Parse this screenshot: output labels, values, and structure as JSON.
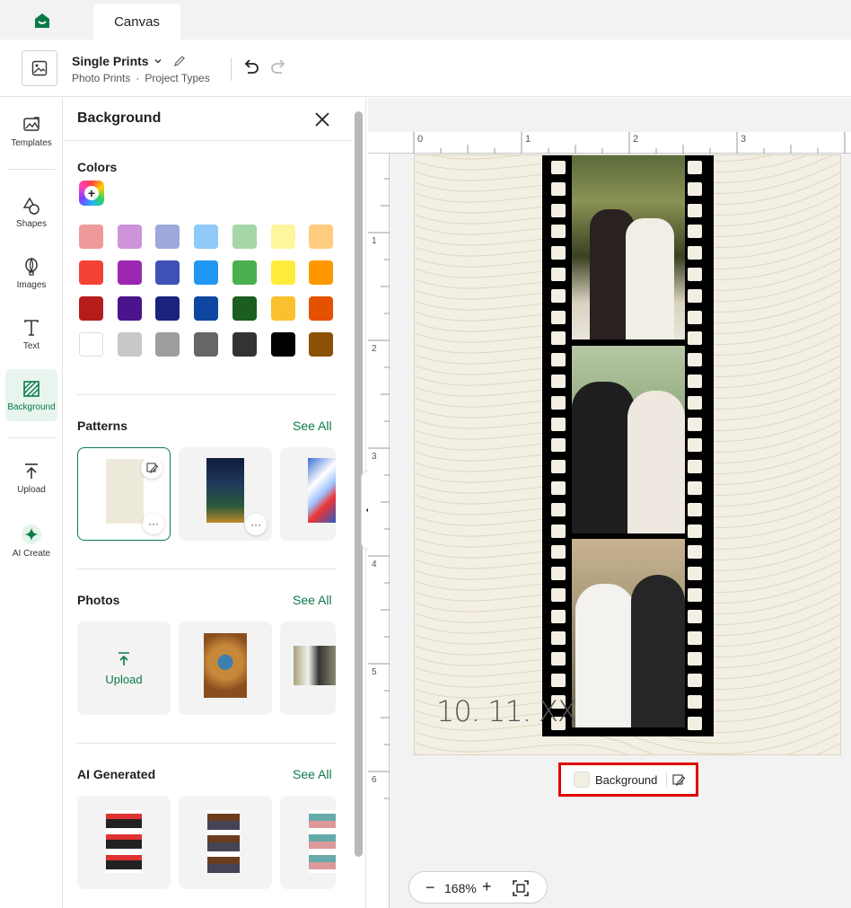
{
  "tabs": {
    "active_tab": "Canvas"
  },
  "project": {
    "title": "Single Prints",
    "category": "Photo Prints",
    "separator": "·",
    "type": "Project Types"
  },
  "rail": {
    "items": [
      {
        "label": "Templates"
      },
      {
        "label": "Shapes"
      },
      {
        "label": "Images"
      },
      {
        "label": "Text"
      },
      {
        "label": "Background"
      },
      {
        "label": "Upload"
      },
      {
        "label": "AI Create"
      }
    ]
  },
  "panel": {
    "title": "Background",
    "colors_title": "Colors",
    "patterns_title": "Patterns",
    "photos_title": "Photos",
    "ai_title": "AI Generated",
    "see_all": "See All",
    "upload_label": "Upload",
    "swatches": [
      [
        "#ef9a9a",
        "#ce93d8",
        "#9fa8da",
        "#90caf9",
        "#a5d6a7",
        "#fff59d",
        "#ffcc80"
      ],
      [
        "#f44336",
        "#9c27b0",
        "#3f51b5",
        "#2196f3",
        "#4caf50",
        "#ffeb3b",
        "#ff9800"
      ],
      [
        "#b71c1c",
        "#4a148c",
        "#1a237e",
        "#0d47a1",
        "#1b5e20",
        "#fbc02d",
        "#e65100"
      ],
      [
        "#ffffff",
        "#c8c8c8",
        "#9e9e9e",
        "#666666",
        "#333333",
        "#000000",
        "#8b5206"
      ]
    ]
  },
  "ruler": {
    "top": [
      "0",
      "1",
      "2",
      "3"
    ],
    "left": [
      "1",
      "2",
      "3",
      "4",
      "5",
      "6"
    ]
  },
  "canvas": {
    "date_text": "10. 11. XX",
    "background_label": "Background",
    "page_color": "#f3efe2"
  },
  "zoom": {
    "level": "168%"
  },
  "accent": "#0a7a47"
}
